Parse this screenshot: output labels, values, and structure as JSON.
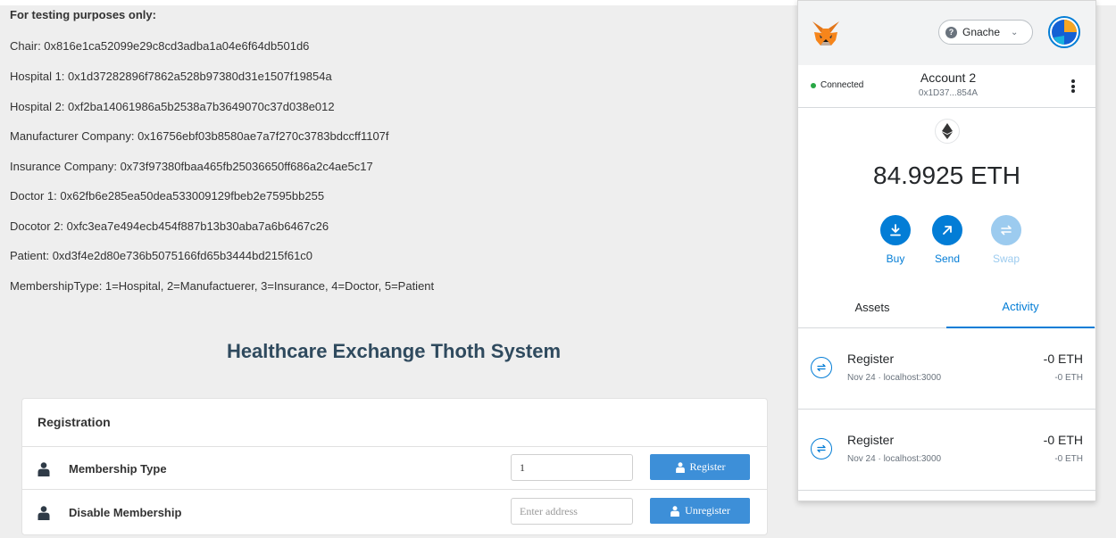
{
  "testing": {
    "heading": "For testing purposes only:",
    "lines": [
      "Chair: 0x816e1ca52099e29c8cd3adba1a04e6f64db501d6",
      "Hospital 1: 0x1d37282896f7862a528b97380d31e1507f19854a",
      "Hospital 2: 0xf2ba14061986a5b2538a7b3649070c37d038e012",
      "Manufacturer Company: 0x16756ebf03b8580ae7a7f270c3783bdccff1107f",
      "Insurance Company: 0x73f97380fbaa465fb25036650ff686a2c4ae5c17",
      "Doctor 1: 0x62fb6e285ea50dea533009129fbeb2e7595bb255",
      "Docotor 2: 0xfc3ea7e494ecb454f887b13b30aba7a6b6467c26",
      "Patient: 0xd3f4e2d80e736b5075166fd65b3444bd215f61c0",
      "MembershipType: 1=Hospital, 2=Manufactuerer, 3=Insurance, 4=Doctor, 5=Patient"
    ]
  },
  "page_title": "Healthcare Exchange Thoth System",
  "registration": {
    "title": "Registration",
    "rows": [
      {
        "label": "Membership Type",
        "input_value": "1",
        "input_placeholder": "",
        "button_label": "Register",
        "icon": "user-icon"
      },
      {
        "label": "Disable Membership",
        "input_value": "",
        "input_placeholder": "Enter address",
        "button_label": "Unregister",
        "icon": "user-icon"
      }
    ]
  },
  "metamask": {
    "network": "Gnache",
    "status": "Connected",
    "account_name": "Account 2",
    "account_address": "0x1D37...854A",
    "balance": "84.9925 ETH",
    "actions": [
      {
        "label": "Buy",
        "icon": "download-icon",
        "enabled": true
      },
      {
        "label": "Send",
        "icon": "arrow-up-right-icon",
        "enabled": true
      },
      {
        "label": "Swap",
        "icon": "swap-icon",
        "enabled": false
      }
    ],
    "tabs": [
      {
        "label": "Assets",
        "active": false
      },
      {
        "label": "Activity",
        "active": true
      }
    ],
    "transactions": [
      {
        "title": "Register",
        "subtitle": "Nov 24 · localhost:3000",
        "amount": "-0 ETH",
        "amount_secondary": "-0 ETH"
      },
      {
        "title": "Register",
        "subtitle": "Nov 24 · localhost:3000",
        "amount": "-0 ETH",
        "amount_secondary": "-0 ETH"
      }
    ],
    "colors": {
      "accent": "#037dd6",
      "connected": "#28a745"
    }
  }
}
